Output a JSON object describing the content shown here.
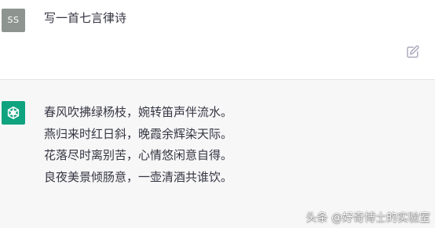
{
  "user": {
    "avatar_initials": "SS",
    "prompt": "写一首七言律诗",
    "avatar_color": "#8e9591"
  },
  "assistant": {
    "avatar_color": "#10a37f",
    "lines": [
      "春风吹拂绿杨枝，婉转笛声伴流水。",
      "燕归来时红日斜，晚霞余辉染天际。",
      "花落尽时离别苦，心情悠闲意自得。",
      "良夜美景倾肠意，一壶清酒共谁饮。"
    ]
  },
  "icons": {
    "edit": "edit-icon",
    "assistant_logo": "openai-logo-icon"
  },
  "watermark": "头条 @好奇博士的实验室"
}
